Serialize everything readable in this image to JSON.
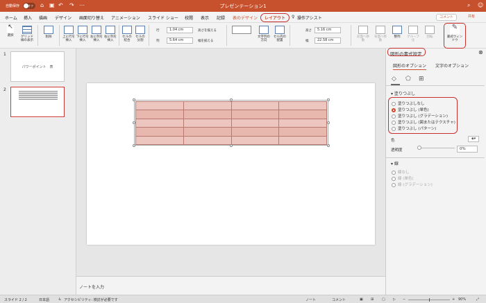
{
  "titlebar": {
    "autosave": "自動保存",
    "autosave_state": "オフ",
    "title": "プレゼンテーション1"
  },
  "tabs": [
    "ホーム",
    "挿入",
    "描画",
    "デザイン",
    "画面切り替え",
    "アニメーション",
    "スライド ショー",
    "校閲",
    "表示",
    "記録",
    "表のデザイン",
    "レイアウト",
    "操作アシスト"
  ],
  "tab_buttons": {
    "comment": "コメント",
    "share": "共有"
  },
  "ribbon": {
    "select": "選択",
    "gridlines": "グリッド線の表示",
    "delete": "削除",
    "insert_above": "上に行を挿入",
    "insert_below": "下に行を挿入",
    "insert_left": "左に列を挿入",
    "insert_right": "右に列を挿入",
    "merge": "セルの結合",
    "split": "セルの分割",
    "row_label": "行",
    "row_height": "1.04 cm",
    "col_label": "列",
    "col_width": "5.64 cm",
    "distribute_rows": "高さを揃える",
    "distribute_cols": "幅を揃える",
    "text_direction": "文字列の方向",
    "cell_margins": "セル内の配置",
    "height_label": "高さ",
    "height": "5.16 cm",
    "width_label": "幅",
    "width": "22.58 cm",
    "bring_forward": "前面へ移動",
    "send_backward": "背面へ移動",
    "align": "整列",
    "group": "グループ化",
    "rotate": "回転",
    "format_pane": "書式ウィンドウ"
  },
  "slides": [
    {
      "num": "1",
      "title": "パワーポイント　表"
    },
    {
      "num": "2"
    }
  ],
  "notes": "ノートを入力",
  "pane": {
    "title": "図形の書式設定",
    "tab_shape": "図形のオプション",
    "tab_text": "文字のオプション",
    "fill_section": "塗りつぶし",
    "fill_options": [
      "塗りつぶしなし",
      "塗りつぶし (単色)",
      "塗りつぶし (グラデーション)",
      "塗りつぶし (図またはテクスチャ)",
      "塗りつぶし (パターン)"
    ],
    "selected_fill": 1,
    "color_label": "色",
    "transparency_label": "透明度",
    "transparency": "0%",
    "line_section": "線",
    "line_options": [
      "線なし",
      "線 (単色)",
      "線 (グラデーション)"
    ]
  },
  "status": {
    "slide": "スライド 2 / 2",
    "lang": "日本語",
    "accessibility": "アクセシビリティ: 検討が必要です",
    "notes": "ノート",
    "comments": "コメント",
    "zoom": "90%"
  },
  "colors": {
    "accent": "#c8512d",
    "table_fill": "#e8b8ae",
    "highlight": "#c8302d"
  }
}
